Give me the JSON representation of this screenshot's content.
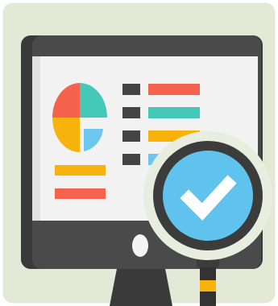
{
  "illustration": {
    "subject": "monitor-with-dashboard-and-magnifier",
    "icons": [
      "monitor-icon",
      "pie-chart-icon",
      "list-icon",
      "magnifying-glass-icon",
      "checkmark-icon"
    ]
  },
  "colors": {
    "background": "#e3e8d7",
    "monitor_body": "#4a4a4a",
    "monitor_body_dark": "#3a3a3a",
    "screen": "#f2f2f2",
    "screen_shadow": "#e2e2e2",
    "pie_red": "#f5624d",
    "pie_teal": "#45c8b8",
    "pie_yellow": "#f7b20c",
    "pie_blue": "#6cc6ef",
    "bar_red": "#f5624d",
    "bar_teal": "#45c8b8",
    "bar_yellow": "#f7b20c",
    "bar_blue": "#6cc6ef",
    "list_bullet": "#444444",
    "power_button": "#f4f4f4",
    "lens_ring_outer": "#ffffff",
    "lens_ring": "#3c3c3c",
    "lens_glass": "#5fc3ee",
    "checkmark": "#ffffff",
    "handle": "#333333",
    "handle_band": "#f7b20c"
  },
  "list_rows": [
    {
      "bar_color": "#f5624d"
    },
    {
      "bar_color": "#45c8b8"
    },
    {
      "bar_color": "#f7b20c"
    },
    {
      "bar_color": "#6cc6ef"
    }
  ]
}
